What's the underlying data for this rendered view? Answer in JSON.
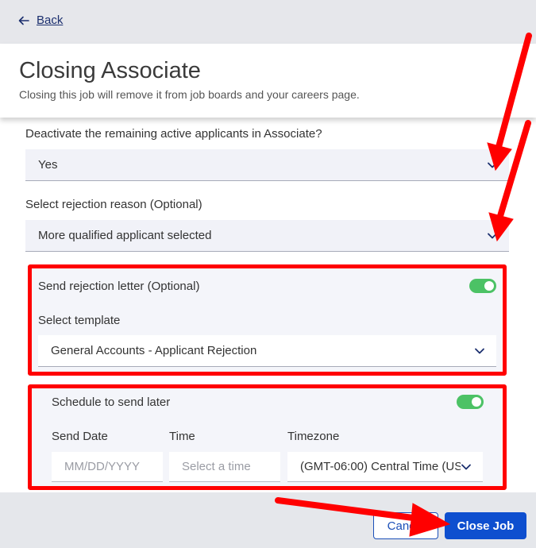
{
  "nav": {
    "back_label": "Back"
  },
  "header": {
    "title": "Closing Associate",
    "subtitle": "Closing this job will remove it from job boards and your careers page."
  },
  "deactivate": {
    "question": "Deactivate the remaining active applicants in Associate?",
    "value": "Yes"
  },
  "rejection_reason": {
    "label": "Select rejection reason (Optional)",
    "value": "More qualified applicant selected"
  },
  "rejection_letter": {
    "label": "Send rejection letter (Optional)",
    "enabled": true,
    "template_label": "Select template",
    "template_value": "General Accounts - Applicant Rejection"
  },
  "schedule": {
    "label": "Schedule to send later",
    "enabled": true,
    "send_date_label": "Send Date",
    "send_date_placeholder": "MM/DD/YYYY",
    "time_label": "Time",
    "time_placeholder": "Select a time",
    "timezone_label": "Timezone",
    "timezone_value": "(GMT-06:00) Central Time (US"
  },
  "footer": {
    "cancel_label": "Cancel",
    "close_label": "Close Job"
  },
  "colors": {
    "accent": "#0e4fcf",
    "toggle_on": "#4cc265",
    "annotation": "#ff0000"
  }
}
